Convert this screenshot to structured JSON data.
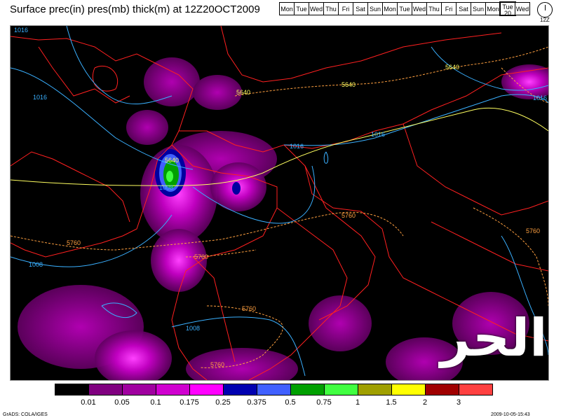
{
  "title": "Surface prec(in) pres(mb) thick(m) at 12Z20OCT2009",
  "days": [
    {
      "label": "Mon"
    },
    {
      "label": "Tue"
    },
    {
      "label": "Wed"
    },
    {
      "label": "Thu"
    },
    {
      "label": "Fri"
    },
    {
      "label": "Sat"
    },
    {
      "label": "Sun"
    },
    {
      "label": "Mon"
    },
    {
      "label": "Tue"
    },
    {
      "label": "Wed"
    },
    {
      "label": "Thu"
    },
    {
      "label": "Fri"
    },
    {
      "label": "Sat"
    },
    {
      "label": "Sun"
    },
    {
      "label": "Mon"
    },
    {
      "label": "Tue",
      "num": "20",
      "current": true
    },
    {
      "label": "Wed"
    }
  ],
  "clock_time": "12Z",
  "contour_labels": {
    "p1016a": "1016",
    "p1016b": "1016",
    "p1016c": "1016",
    "p1016d": "1016",
    "p1016e": "1016",
    "p1008a": "1008",
    "p1008b": "1008",
    "p1008c": "1008",
    "t5640a": "5640",
    "t5640b": "5640",
    "t5640c": "5640",
    "t5640d": "5640",
    "t5760a": "5760",
    "t5760b": "5760",
    "t5760c": "5760",
    "t5760d": "5760",
    "t5760e": "5760",
    "t5760f": "5760"
  },
  "legend": {
    "colors": [
      "#000000",
      "#800080",
      "#a000a0",
      "#d000d0",
      "#ff00ff",
      "#0000b0",
      "#4060ff",
      "#00a000",
      "#40ff40",
      "#a0a000",
      "#ffff00",
      "#a00000",
      "#ff4040"
    ],
    "values": [
      "0.01",
      "0.05",
      "0.1",
      "0.175",
      "0.25",
      "0.375",
      "0.5",
      "0.75",
      "1",
      "1.5",
      "2",
      "3"
    ]
  },
  "footer_left": "GrADS: COLA/IGES",
  "footer_right": "2009-10-05-15:43",
  "watermark": "الحر",
  "colors": {
    "pressure": "#3ab0ff",
    "thickness_low": "#ffff60",
    "thickness_high": "#ffa040",
    "borders": "#ff2020"
  }
}
